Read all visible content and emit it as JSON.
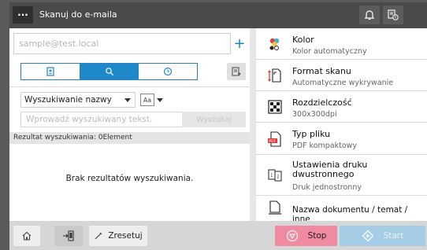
{
  "titlebar": {
    "menu_label": "···",
    "title": "Skanuj do e-maila"
  },
  "address": {
    "placeholder": "sample@test.local",
    "add_label": "+"
  },
  "search": {
    "mode_label": "Wyszukiwanie nazwy",
    "case_label": "Aa",
    "input_placeholder": "Wprowadź wyszukiwany tekst.",
    "button_label": "Wyszukaj",
    "result_label": "Rezultat wyszukiwania: 0Element",
    "no_results": "Brak rezultatów wyszukiwania."
  },
  "settings": [
    {
      "label": "Kolor",
      "value": "Kolor automatyczny",
      "icon": "color-icon"
    },
    {
      "label": "Format skanu",
      "value": "Automatyczne wykrywanie",
      "icon": "scan-format-icon"
    },
    {
      "label": "Rozdzielczość",
      "value": "300x300dpi",
      "icon": "resolution-icon"
    },
    {
      "label": "Typ pliku",
      "value": "PDF kompaktowy",
      "icon": "pdf-file-icon"
    },
    {
      "label": "Ustawienia druku dwustronnego",
      "value": "Druk jednostronny",
      "icon": "duplex-icon"
    },
    {
      "label": "Nazwa dokumentu / temat / inne",
      "value": "",
      "icon": "document-name-icon"
    }
  ],
  "bottom": {
    "reset_label": "Zresetuj",
    "stop_label": "Stop",
    "start_label": "Start"
  },
  "colors": {
    "accent": "#1f88c9",
    "stop": "#f08aa0",
    "start": "#a6cde6",
    "titlebar": "#4a4a4a"
  }
}
